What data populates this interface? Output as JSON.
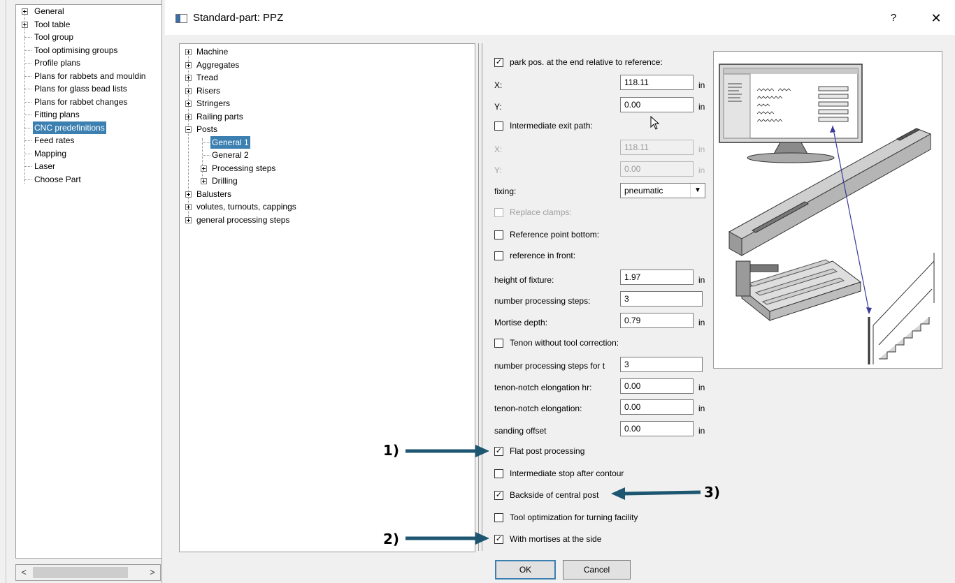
{
  "left_tree": {
    "items": [
      {
        "label": "General",
        "expand": "plus"
      },
      {
        "label": "Tool table",
        "expand": "plus"
      },
      {
        "label": "Tool group",
        "expand": ""
      },
      {
        "label": "Tool optimising groups",
        "expand": ""
      },
      {
        "label": "Profile plans",
        "expand": ""
      },
      {
        "label": "Plans for rabbets and mouldin",
        "expand": ""
      },
      {
        "label": "Plans for glass bead lists",
        "expand": ""
      },
      {
        "label": "Plans for rabbet changes",
        "expand": ""
      },
      {
        "label": "Fitting plans",
        "expand": ""
      },
      {
        "label": "CNC predefinitions",
        "expand": "",
        "selected": true
      },
      {
        "label": "Feed rates",
        "expand": ""
      },
      {
        "label": "Mapping",
        "expand": ""
      },
      {
        "label": "Laser",
        "expand": ""
      },
      {
        "label": "Choose Part",
        "expand": ""
      }
    ]
  },
  "dialog": {
    "title": "Standard-part: PPZ",
    "help_label": "?",
    "close_label": "✕",
    "ok_label": "OK",
    "cancel_label": "Cancel"
  },
  "category_tree": {
    "items": [
      {
        "label": "Machine",
        "level": 0,
        "expand": "plus"
      },
      {
        "label": "Aggregates",
        "level": 0,
        "expand": "plus"
      },
      {
        "label": "Tread",
        "level": 0,
        "expand": "plus"
      },
      {
        "label": "Risers",
        "level": 0,
        "expand": "plus"
      },
      {
        "label": "Stringers",
        "level": 0,
        "expand": "plus"
      },
      {
        "label": "Railing parts",
        "level": 0,
        "expand": "plus"
      },
      {
        "label": "Posts",
        "level": 0,
        "expand": "minus"
      },
      {
        "label": "General  1",
        "level": 1,
        "expand": "",
        "selected": true
      },
      {
        "label": "General  2",
        "level": 1,
        "expand": ""
      },
      {
        "label": "Processing steps",
        "level": 1,
        "expand": "plus"
      },
      {
        "label": "Drilling",
        "level": 1,
        "expand": "plus"
      },
      {
        "label": "Balusters",
        "level": 0,
        "expand": "plus"
      },
      {
        "label": "volutes, turnouts, cappings",
        "level": 0,
        "expand": "plus"
      },
      {
        "label": "general processing steps",
        "level": 0,
        "expand": "plus"
      }
    ]
  },
  "settings": {
    "park_pos": {
      "label": "park pos. at the end relative to reference:",
      "checked": true
    },
    "x": {
      "label": "X:",
      "value": "118.11",
      "unit": "in"
    },
    "y": {
      "label": "Y:",
      "value": "0.00",
      "unit": "in"
    },
    "intermediate_exit": {
      "label": "Intermediate exit path:",
      "checked": false
    },
    "exit_x": {
      "label": "X:",
      "value": "118.11",
      "unit": "in"
    },
    "exit_y": {
      "label": "Y:",
      "value": "0.00",
      "unit": "in"
    },
    "fixing": {
      "label": "fixing:",
      "value": "pneumatic"
    },
    "replace_clamps": {
      "label": "Replace clamps:",
      "checked": false
    },
    "reference_bottom": {
      "label": "Reference point bottom:",
      "checked": false
    },
    "reference_front": {
      "label": "reference in front:",
      "checked": false
    },
    "height_fixture": {
      "label": "height of fixture:",
      "value": "1.97",
      "unit": "in"
    },
    "num_steps": {
      "label": "number processing steps:",
      "value": "3"
    },
    "mortise_depth": {
      "label": "Mortise depth:",
      "value": "0.79",
      "unit": "in"
    },
    "tenon_no_correction": {
      "label": "Tenon without tool correction:",
      "checked": false
    },
    "num_steps_t": {
      "label": "number processing steps for t",
      "value": "3"
    },
    "tenon_notch_hr": {
      "label": "tenon-notch elongation hr:",
      "value": "0.00",
      "unit": "in"
    },
    "tenon_notch": {
      "label": "tenon-notch elongation:",
      "value": "0.00",
      "unit": "in"
    },
    "sanding_offset": {
      "label": "sanding offset",
      "value": "0.00",
      "unit": "in"
    },
    "flat_post": {
      "label": "Flat post processing",
      "checked": true
    },
    "intermediate_stop": {
      "label": "Intermediate stop after contour",
      "checked": false
    },
    "backside_central": {
      "label": "Backside of central post",
      "checked": true
    },
    "tool_optimization": {
      "label": "Tool optimization for turning facility",
      "checked": false
    },
    "mortises_side": {
      "label": "With mortises at the side",
      "checked": true
    }
  },
  "annotations": {
    "a1": "1)",
    "a2": "2)",
    "a3": "3)"
  },
  "colors": {
    "selection": "#3c7fb1",
    "annotation_arrow": "#1d5670"
  },
  "icons": {
    "cursor": "mouse-pointer-icon",
    "dropdown": "chevron-down-icon"
  }
}
